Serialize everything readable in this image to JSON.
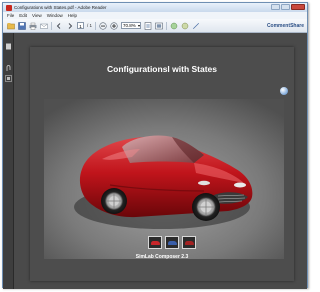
{
  "window": {
    "title": "Configurations with States.pdf - Adobe Reader"
  },
  "menu": {
    "items": [
      "File",
      "Edit",
      "View",
      "Window",
      "Help"
    ]
  },
  "toolbar": {
    "page_current": "1",
    "page_total": "/ 1",
    "zoom": "70.8%",
    "comment_label": "Comment",
    "share_label": "Share"
  },
  "document": {
    "title": "Configurationsl with States",
    "footer": "SimLab Composer 2.3",
    "thumbnails": [
      "red-car-thumbnail",
      "blue-car-thumbnail",
      "dark-red-car-thumbnail"
    ]
  },
  "colors": {
    "car_body": "#c0141b",
    "page_bg": "#4d4d4d",
    "app_bg": "#4a4a4a"
  }
}
